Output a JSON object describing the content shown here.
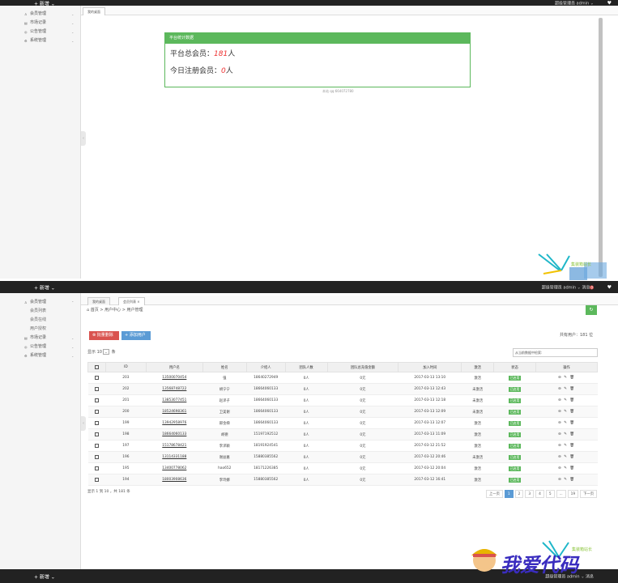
{
  "top1": {
    "add_label": "+ 新增 ⌄",
    "admin_label": "超级管理员 admin ⌄",
    "msg_label": "消息",
    "badge": "",
    "icon": "♥"
  },
  "top2": {
    "add_label": "+ 新增 ⌄",
    "admin_label": "超级管理员 admin ⌄",
    "msg_label": "消息",
    "badge": "0",
    "icon": "♥"
  },
  "top3": {
    "add_label": "+ 新增 ⌄",
    "admin_label": "超级管理员 admin ⌄",
    "msg_label": "消息"
  },
  "sidebar1": [
    "会员管理",
    "市场记录",
    "公告管理",
    "系统管理"
  ],
  "sidebar2": {
    "items": [
      "会员管理",
      "市场记录",
      "公告管理",
      "系统管理"
    ],
    "subitems": [
      "会员列表",
      "会员在线",
      "用户授权"
    ]
  },
  "tabs1": {
    "home": "我的桌面"
  },
  "tabs2": {
    "home": "我的桌面",
    "list": "会员列表 ×"
  },
  "stats": {
    "header": "平台统计数据",
    "total_label": "平台总会员：",
    "total_value": "181",
    "total_unit": "人",
    "today_label": "今日注册会员：",
    "today_value": "0",
    "today_unit": "人",
    "footnote": "本站 qq:664072780"
  },
  "breadcrumb": "⌂ 首页 > 用户中心 > 用户管理",
  "toolbar": {
    "delete_label": "⊗ 批量删除",
    "add_label": "+ 添加用户",
    "total": "共有用户：181 位"
  },
  "table_controls": {
    "show_prefix": "显示",
    "show_value": "10",
    "show_suffix": "条",
    "search_placeholder": "从当前数据中检索:"
  },
  "table": {
    "headers": [
      "",
      "ID",
      "用户名",
      "姓名",
      "介绍人",
      "团队人数",
      "团队总充值金额",
      "加入时间",
      "激活",
      "状态",
      "操作"
    ],
    "rows": [
      [
        "203",
        "13500070454",
        "强",
        "18640272949",
        "0人",
        "0元",
        "2017-03-13 13:10",
        "激活",
        "已启用"
      ],
      [
        "202",
        "13568748722",
        "胡宁宁",
        "18664060133",
        "0人",
        "0元",
        "2017-03-13 12:43",
        "未激活",
        "已启用"
      ],
      [
        "201",
        "13853077451",
        "赵泽子",
        "18664060133",
        "0人",
        "0元",
        "2017-03-13 12:18",
        "未激活",
        "已启用"
      ],
      [
        "200",
        "18524698361",
        "卫美谢",
        "18664060133",
        "0人",
        "0元",
        "2017-03-13 12:09",
        "未激活",
        "已启用"
      ],
      [
        "199",
        "13942958976",
        "邢金梯",
        "18664060133",
        "0人",
        "0元",
        "2017-03-13 12:07",
        "激活",
        "已启用"
      ],
      [
        "198",
        "18664060133",
        "胡德",
        "15197192512",
        "0人",
        "0元",
        "2017-03-13 11:09",
        "激活",
        "已启用"
      ],
      [
        "197",
        "15178678421",
        "李泽颖",
        "18191924541",
        "0人",
        "0元",
        "2017-03-12 21:52",
        "激活",
        "已启用"
      ],
      [
        "196",
        "13114331188",
        "谢益嘉",
        "15880385562",
        "0人",
        "0元",
        "2017-03-12 20:46",
        "未激活",
        "已启用"
      ],
      [
        "195",
        "13400778062",
        "hao652",
        "18171226385",
        "0人",
        "0元",
        "2017-03-12 20:04",
        "激活",
        "已启用"
      ],
      [
        "194",
        "18003908636",
        "李玲娜",
        "15880385562",
        "0人",
        "0元",
        "2017-03-12 16:41",
        "激活",
        "已启用"
      ]
    ],
    "ops": "⊖ ✎ 🗑"
  },
  "pagination": {
    "info": "显示 1 到 10 ，共 181 条",
    "prev": "上一页",
    "pages": [
      "1",
      "2",
      "3",
      "4",
      "5",
      "...",
      "19"
    ],
    "next": "下一页"
  },
  "watermark": {
    "text": "我爱代码",
    "site_text": "集装箱站长"
  }
}
